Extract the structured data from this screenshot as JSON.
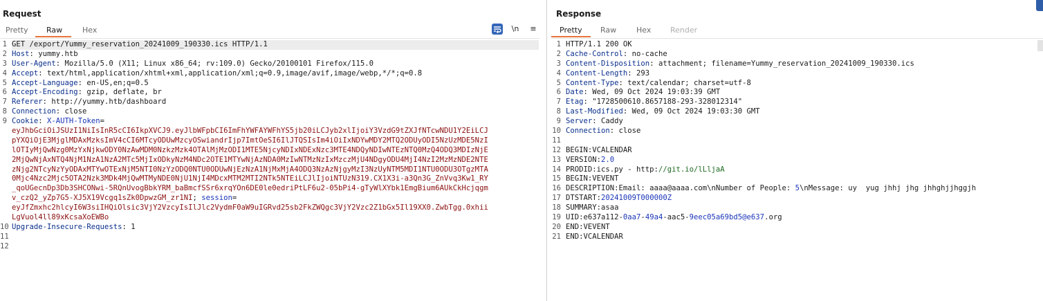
{
  "request": {
    "title": "Request",
    "tabs": [
      "Pretty",
      "Raw",
      "Hex"
    ],
    "active_tab": "Raw",
    "toolbar": {
      "render_label": "\\n",
      "menu_label": "≡",
      "wrap_icon": "word-wrap-icon"
    },
    "line_numbers": [
      "1",
      "2",
      "3",
      "4",
      "5",
      "6",
      "7",
      "8",
      "9",
      "",
      "",
      "",
      "",
      "",
      "",
      "",
      "",
      "",
      "",
      "10",
      "11",
      "12"
    ],
    "lines": [
      [
        {
          "t": "GET /export/Yummy_reservation_20241009_190330.ics HTTP/1.1"
        }
      ],
      [
        {
          "t": "Host",
          "c": "hname"
        },
        {
          "t": ": yummy.htb"
        }
      ],
      [
        {
          "t": "User-Agent",
          "c": "hname"
        },
        {
          "t": ": Mozilla/5.0 (X11; Linux x86_64; rv:109.0) Gecko/20100101 Firefox/115.0"
        }
      ],
      [
        {
          "t": "Accept",
          "c": "hname"
        },
        {
          "t": ": text/html,application/xhtml+xml,application/xml;q=0.9,image/avif,image/webp,*/*;q=0.8"
        }
      ],
      [
        {
          "t": "Accept-Language",
          "c": "hname"
        },
        {
          "t": ": en-US,en;q=0.5"
        }
      ],
      [
        {
          "t": "Accept-Encoding",
          "c": "hname"
        },
        {
          "t": ": gzip, deflate, br"
        }
      ],
      [
        {
          "t": "Referer",
          "c": "hname"
        },
        {
          "t": ": http://yummy.htb/dashboard"
        }
      ],
      [
        {
          "t": "Connection",
          "c": "hname"
        },
        {
          "t": ": close"
        }
      ],
      [
        {
          "t": "Cookie",
          "c": "hname"
        },
        {
          "t": ": "
        },
        {
          "t": "X-AUTH-Token",
          "c": "blue"
        },
        {
          "t": "="
        }
      ],
      [
        {
          "t": "eyJhbGciOiJSUzI1NiIsInR5cCI6IkpXVCJ9.eyJlbWFpbCI6ImFhYWFAYWFhYS5jb20iLCJyb2xlIjoiY3VzdG9tZXJfNTcwNDU1Y2EiLCJ",
          "c": "red"
        }
      ],
      [
        {
          "t": "pYXQiOjE3MjglMDAxMzksImV4cCI6MTcyODUwMzcyOSwiandrIjp7ImtOeSI6IlJTQSIsIm4iOiIxNDYwMDY2MTQ2ODUyODI5NzUzMDE5NzI",
          "c": "red"
        }
      ],
      [
        {
          "t": "lOTIyMjQwNzg0MzYxNjkwODY0NzAwMDM0NzkzMzk4OTAlMjMzODI1MTE5NjcyNDIxNDExNzc3MTE4NDQyNDIwNTEzNTQ0MzQ4ODQ3MDIzNjE",
          "c": "red"
        }
      ],
      [
        {
          "t": "2MjQwNjAxNTQ4NjM1NzA1NzA2MTc5MjIxODkyNzM4NDc2OTE1MTYwNjAzNDA0MzIwNTMzNzIxMzczMjU4NDgyODU4MjI4NzI2MzMzNDE2NTE",
          "c": "red"
        }
      ],
      [
        {
          "t": "zNjg2NTcyNzYyODAxMTYwOTExNjM5NTI0NzYzODQ0NTU0ODUwNjEzNzA1NjMxMjA4ODQ3NzAzNjgyMzI3NzUyNTM5MDI1NTU0ODU3OTgzMTA",
          "c": "red"
        }
      ],
      [
        {
          "t": "0Mjc4Nzc2Mjc5OTA2Nzk3MDk4MjQwMTMyNDE0NjU1NjI4MDcxMTM2MTI2NTk5NTEiLCJlIjoiNTUzN319.CX1X3i-a3Qn3G_ZnVvq3Kw1_RY",
          "c": "red"
        }
      ],
      [
        {
          "t": "_qoUGecnDp3Db3SHCONwi-5RQnUvogBbkYRM_baBmcfSSr6xrqYOn6DE0le0edriPtLF6u2-05bPi4-gTyWlXYbk1EmgBium6AUkCkHcjqgm",
          "c": "red"
        }
      ],
      [
        {
          "t": "v_czQ2_yZp7G5-XJ5X19Vcgq1sZk0DpwzGM_zr1NI",
          "c": "red"
        },
        {
          "t": "; "
        },
        {
          "t": "session",
          "c": "blue"
        },
        {
          "t": "="
        }
      ],
      [
        {
          "t": "eyJfZmxhc2hlcyI6W3siIHQiOlsic3VjY2VzcyIsIlJlc2VydmF0aW9uIGRvd25sb2FkZWQgc3VjY2Vzc2Z1bGx5Il19XX0.ZwbTgg.0xhii",
          "c": "red"
        }
      ],
      [
        {
          "t": "LgVuol4ll89xKcsaXoEWBo",
          "c": "red"
        }
      ],
      [
        {
          "t": "Upgrade-Insecure-Requests",
          "c": "hname"
        },
        {
          "t": ": 1"
        }
      ],
      [
        {
          "t": ""
        }
      ],
      [
        {
          "t": ""
        }
      ]
    ]
  },
  "response": {
    "title": "Response",
    "tabs": [
      "Pretty",
      "Raw",
      "Hex",
      "Render"
    ],
    "active_tab": "Pretty",
    "line_numbers": [
      "1",
      "2",
      "3",
      "4",
      "5",
      "6",
      "7",
      "8",
      "9",
      "10",
      "11",
      "12",
      "13",
      "14",
      "15",
      "16",
      "17",
      "18",
      "19",
      "20",
      "21"
    ],
    "lines": [
      [
        {
          "t": "HTTP/1.1 200 OK"
        }
      ],
      [
        {
          "t": "Cache-Control",
          "c": "hname"
        },
        {
          "t": ": no-cache"
        }
      ],
      [
        {
          "t": "Content-Disposition",
          "c": "hname"
        },
        {
          "t": ": attachment; filename=Yummy_reservation_20241009_190330.ics"
        }
      ],
      [
        {
          "t": "Content-Length",
          "c": "hname"
        },
        {
          "t": ": 293"
        }
      ],
      [
        {
          "t": "Content-Type",
          "c": "hname"
        },
        {
          "t": ": text/calendar; charset=utf-8"
        }
      ],
      [
        {
          "t": "Date",
          "c": "hname"
        },
        {
          "t": ": Wed, 09 Oct 2024 19:03:39 GMT"
        }
      ],
      [
        {
          "t": "Etag",
          "c": "hname"
        },
        {
          "t": ": \"1728500610.8657188-293-328012314\""
        }
      ],
      [
        {
          "t": "Last-Modified",
          "c": "hname"
        },
        {
          "t": ": Wed, 09 Oct 2024 19:03:30 GMT"
        }
      ],
      [
        {
          "t": "Server",
          "c": "hname"
        },
        {
          "t": ": Caddy"
        }
      ],
      [
        {
          "t": "Connection",
          "c": "hname"
        },
        {
          "t": ": close"
        }
      ],
      [
        {
          "t": ""
        }
      ],
      [
        {
          "t": "BEGIN:VCALENDAR"
        }
      ],
      [
        {
          "t": "VERSION:"
        },
        {
          "t": "2.0",
          "c": "blue"
        }
      ],
      [
        {
          "t": "PRODID:ics.py - http:"
        },
        {
          "t": "//git.io/lLljaA",
          "c": "green"
        }
      ],
      [
        {
          "t": "BEGIN:VEVENT"
        }
      ],
      [
        {
          "t": "DESCRIPTION:Email: aaaa@aaaa.com\\nNumber of People: "
        },
        {
          "t": "5",
          "c": "blue"
        },
        {
          "t": "\\nMessage: uy  yug jhhj jhg jhhghjjhggjh"
        }
      ],
      [
        {
          "t": "DTSTART:"
        },
        {
          "t": "20241009T000000Z",
          "c": "blue"
        }
      ],
      [
        {
          "t": "SUMMARY:asaa"
        }
      ],
      [
        {
          "t": "UID:e637a112-"
        },
        {
          "t": "0aa7",
          "c": "blue"
        },
        {
          "t": "-"
        },
        {
          "t": "49a4",
          "c": "blue"
        },
        {
          "t": "-aac5-"
        },
        {
          "t": "9eec05a69bd5@e637",
          "c": "blue"
        },
        {
          "t": ".org"
        }
      ],
      [
        {
          "t": "END:VEVENT"
        }
      ],
      [
        {
          "t": "END:VCALENDAR"
        }
      ]
    ]
  }
}
